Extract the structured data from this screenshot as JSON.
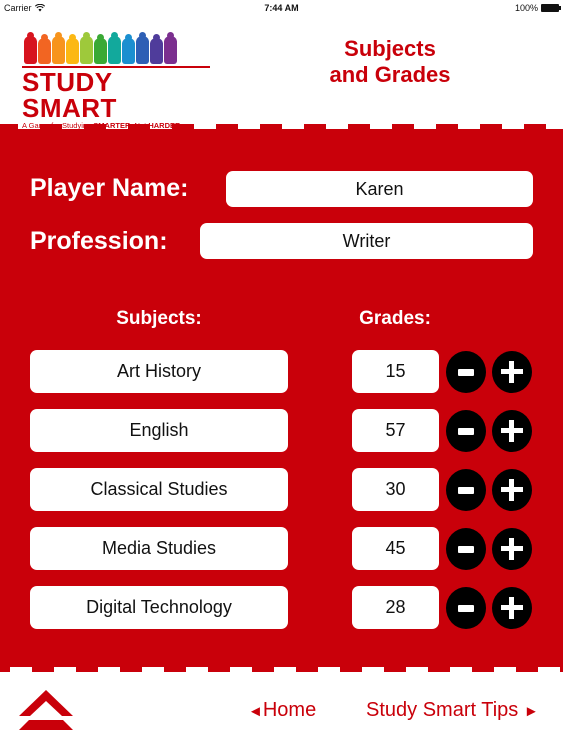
{
  "status_bar": {
    "carrier": "Carrier",
    "wifi_icon": "wifi-icon",
    "time": "7:44 AM",
    "battery_percent": "100%",
    "battery_icon": "battery-icon"
  },
  "logo": {
    "brand": "STUDY SMART",
    "tagline_prefix": "A Game for Studying ",
    "tagline_bold1": "SMARTER",
    "tagline_middle": ", Not ",
    "tagline_bold2": "HARDER",
    "kid_colors": [
      "#d7141e",
      "#f26522",
      "#f7941d",
      "#fcb813",
      "#9ec93b",
      "#3aa935",
      "#12a99c",
      "#1b8fd0",
      "#2e5fb5",
      "#4f3c9b",
      "#7b2f8f"
    ]
  },
  "header": {
    "title_line1": "Subjects",
    "title_line2": "and Grades"
  },
  "colors": {
    "brand_red": "#c9000a",
    "button_black": "#000000"
  },
  "player": {
    "name_label": "Player Name:",
    "name_value": "Karen",
    "profession_label": "Profession:",
    "profession_value": "Writer"
  },
  "table": {
    "subjects_header": "Subjects:",
    "grades_header": "Grades:",
    "rows": [
      {
        "subject": "Art History",
        "grade": "15"
      },
      {
        "subject": "English",
        "grade": "57"
      },
      {
        "subject": "Classical Studies",
        "grade": "30"
      },
      {
        "subject": "Media Studies",
        "grade": "45"
      },
      {
        "subject": "Digital Technology",
        "grade": "28"
      }
    ]
  },
  "footer": {
    "up_icon": "double-chevron-up-icon",
    "home_arrow": "◄",
    "home_label": "Home",
    "tips_label": "Study Smart Tips",
    "tips_arrow": "►"
  }
}
